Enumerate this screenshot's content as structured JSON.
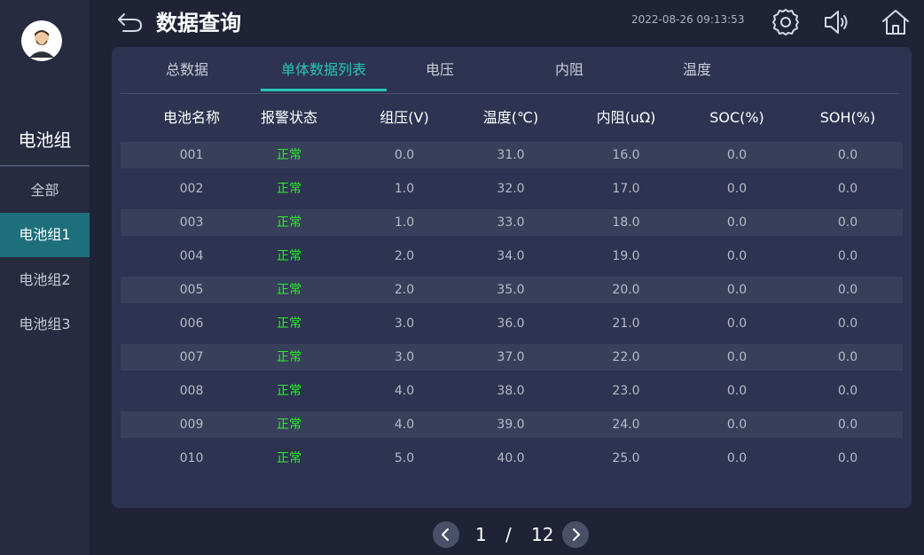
{
  "sidebar": {
    "title": "电池组",
    "items": [
      {
        "label": "全部",
        "active": false
      },
      {
        "label": "电池组1",
        "active": true
      },
      {
        "label": "电池组2",
        "active": false
      },
      {
        "label": "电池组3",
        "active": false
      }
    ]
  },
  "header": {
    "title": "数据查询",
    "datetime": "2022-08-26 09:13:53"
  },
  "tabs": [
    {
      "label": "总数据",
      "active": false
    },
    {
      "label": "单体数据列表",
      "active": true
    },
    {
      "label": "电压",
      "active": false
    },
    {
      "label": "内阻",
      "active": false
    },
    {
      "label": "温度",
      "active": false
    }
  ],
  "table": {
    "columns": [
      "电池名称",
      "报警状态",
      "组压(V)",
      "温度(℃)",
      "内阻(uΩ)",
      "SOC(%)",
      "SOH(%)"
    ],
    "rows": [
      [
        "001",
        "正常",
        "0.0",
        "31.0",
        "16.0",
        "0.0",
        "0.0"
      ],
      [
        "002",
        "正常",
        "1.0",
        "32.0",
        "17.0",
        "0.0",
        "0.0"
      ],
      [
        "003",
        "正常",
        "1.0",
        "33.0",
        "18.0",
        "0.0",
        "0.0"
      ],
      [
        "004",
        "正常",
        "2.0",
        "34.0",
        "19.0",
        "0.0",
        "0.0"
      ],
      [
        "005",
        "正常",
        "2.0",
        "35.0",
        "20.0",
        "0.0",
        "0.0"
      ],
      [
        "006",
        "正常",
        "3.0",
        "36.0",
        "21.0",
        "0.0",
        "0.0"
      ],
      [
        "007",
        "正常",
        "3.0",
        "37.0",
        "22.0",
        "0.0",
        "0.0"
      ],
      [
        "008",
        "正常",
        "4.0",
        "38.0",
        "23.0",
        "0.0",
        "0.0"
      ],
      [
        "009",
        "正常",
        "4.0",
        "39.0",
        "24.0",
        "0.0",
        "0.0"
      ],
      [
        "010",
        "正常",
        "5.0",
        "40.0",
        "25.0",
        "0.0",
        "0.0"
      ]
    ]
  },
  "pagination": {
    "current": "1",
    "separator": "/",
    "total": "12"
  },
  "colors": {
    "accent": "#27c5b5",
    "status_ok": "#29f029",
    "sidebar_active": "#1d6f7b",
    "background": "#1f2335",
    "panel": "#2d3350"
  },
  "icons": {
    "back": "back-arrow-icon",
    "settings": "gear-icon",
    "sound": "speaker-icon",
    "home": "home-icon",
    "prev": "chevron-left-icon",
    "next": "chevron-right-icon"
  }
}
